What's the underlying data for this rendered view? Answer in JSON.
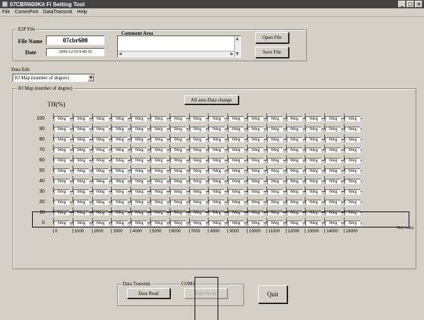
{
  "window": {
    "title": "07CBR600Kit Fi Setting Tool"
  },
  "menu": [
    "File",
    "CommPort",
    "DataTransmit",
    "Help"
  ],
  "e2p": {
    "group_label": "E2P File",
    "file_name_label": "File Name",
    "file_name_value": "07cbr600",
    "date_label": "Date",
    "date_value": "2006/12/19 9:40:30",
    "comment_label": "Comment Area",
    "open_label": "Open File",
    "save_label": "Save File"
  },
  "data_edit": {
    "group_label": "Data Edit",
    "selected": "IO Map (number of degree)"
  },
  "map": {
    "group_label": "IO Map (number of degree)",
    "all_area_label": "All area Data change",
    "y_axis_label": "TH(%)",
    "x_axis_unit": "Ne(r/min)",
    "rows": [
      "100",
      "90",
      "80",
      "70",
      "60",
      "50",
      "40",
      "30",
      "20",
      "10",
      "0"
    ],
    "cols": [
      "0",
      "1000",
      "2000",
      "3000",
      "4000",
      "5000",
      "6000",
      "7000",
      "8000",
      "9000",
      "10000",
      "11000",
      "12000",
      "13000",
      "14000",
      "16000"
    ],
    "cell_value": "0deg"
  },
  "transmit": {
    "group_label": "Data Transmit",
    "port_label": "COM1",
    "read_label": "Data Read",
    "write_label": "Data Write"
  },
  "quit_label": "Quit"
}
